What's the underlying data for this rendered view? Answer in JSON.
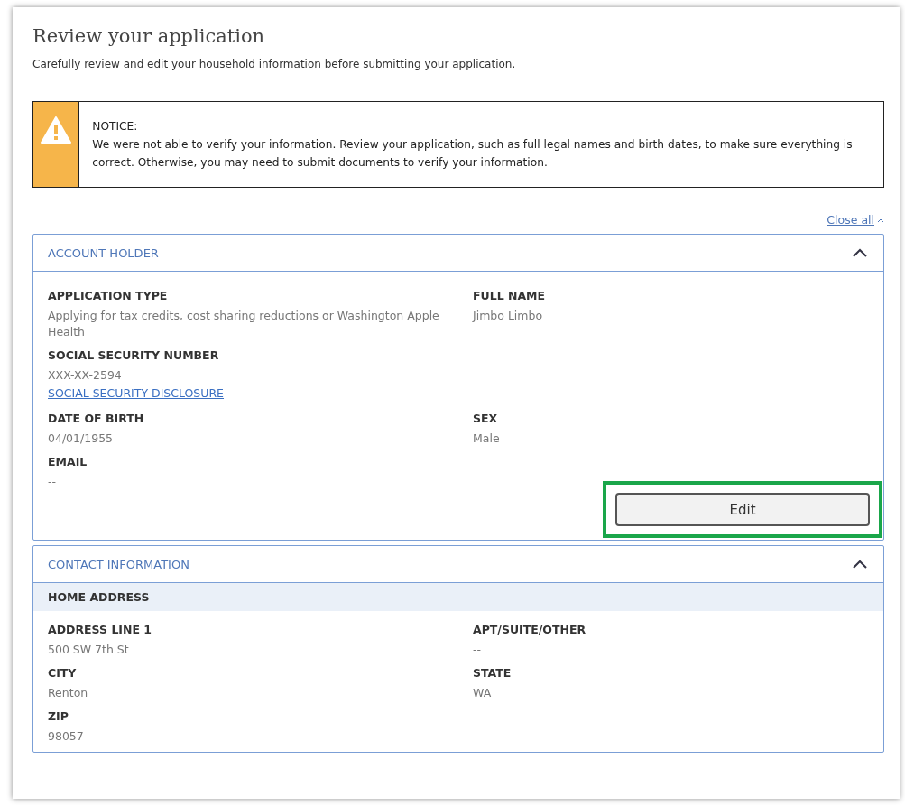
{
  "page": {
    "title": "Review your application",
    "subtitle": "Carefully review and edit your household information before submitting your application."
  },
  "notice": {
    "heading": "NOTICE:",
    "text": "We were not able to verify your information. Review your application, such as full legal names and birth dates, to make sure everything is correct. Otherwise, you may need to submit documents to verify your information."
  },
  "close_all": {
    "label": "Close all"
  },
  "sections": [
    {
      "title": "ACCOUNT HOLDER",
      "expanded": true,
      "rows": [
        [
          {
            "label": "APPLICATION TYPE",
            "value": "Applying for tax credits, cost sharing reductions or Washington Apple Health"
          },
          {
            "label": "FULL NAME",
            "value": "Jimbo Limbo"
          }
        ],
        [
          {
            "label": "SOCIAL SECURITY NUMBER",
            "value": "XXX-XX-2594",
            "link": "SOCIAL SECURITY DISCLOSURE"
          }
        ],
        [
          {
            "label": "DATE OF BIRTH",
            "value": "04/01/1955"
          },
          {
            "label": "SEX",
            "value": "Male"
          }
        ],
        [
          {
            "label": "EMAIL",
            "value": "--"
          }
        ]
      ],
      "edit_button": {
        "label": "Edit",
        "highlighted": true
      }
    },
    {
      "title": "CONTACT INFORMATION",
      "expanded": true,
      "subheader": "HOME ADDRESS",
      "rows": [
        [
          {
            "label": "ADDRESS LINE 1",
            "value": "500 SW 7th St"
          },
          {
            "label": "APT/SUITE/OTHER",
            "value": "--"
          }
        ],
        [
          {
            "label": "CITY",
            "value": "Renton"
          },
          {
            "label": "STATE",
            "value": "WA"
          }
        ],
        [
          {
            "label": "ZIP",
            "value": "98057"
          }
        ]
      ]
    }
  ]
}
